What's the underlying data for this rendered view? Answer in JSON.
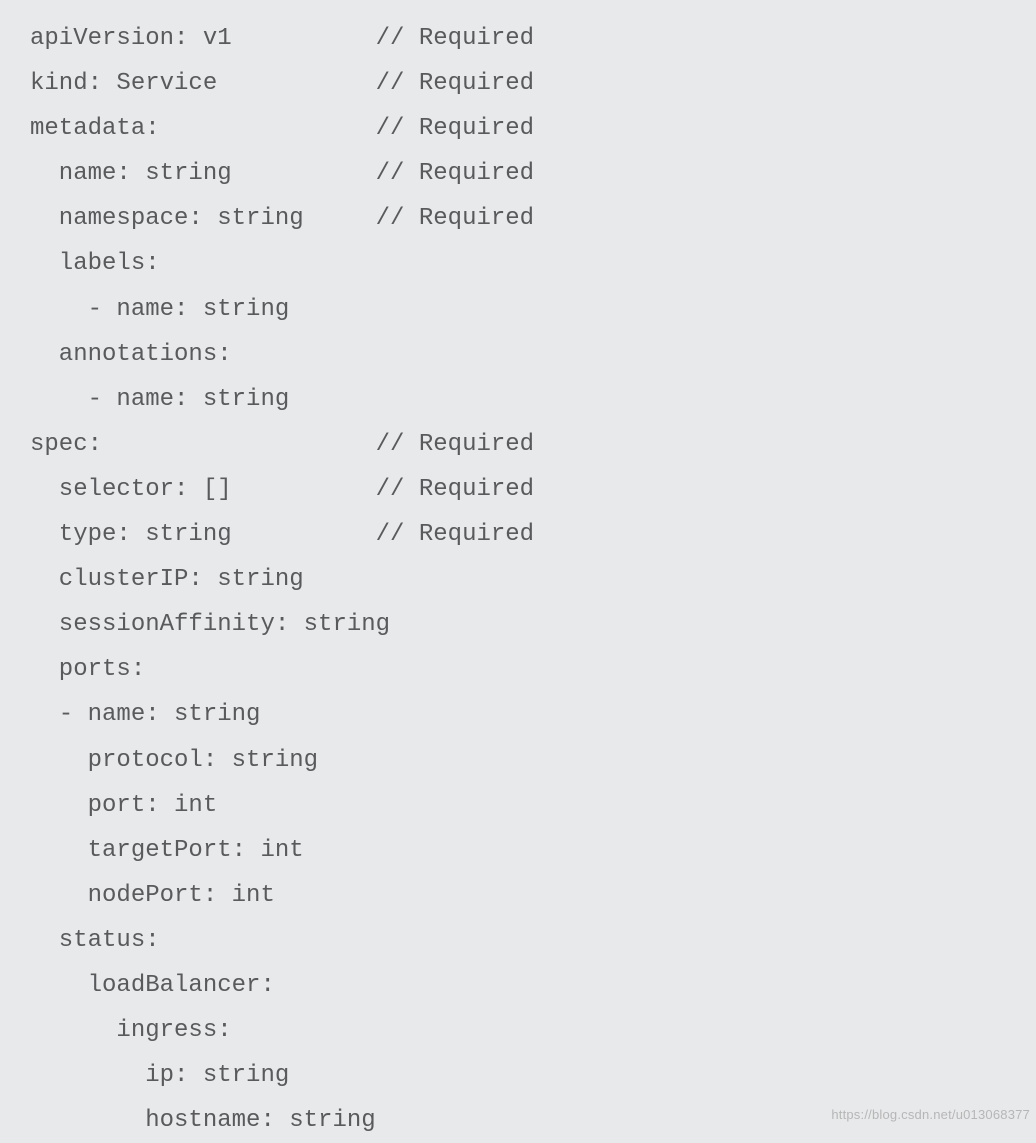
{
  "lines": [
    {
      "code": "apiVersion: v1",
      "pad": 24,
      "comment": "// Required"
    },
    {
      "code": "kind: Service",
      "pad": 24,
      "comment": "// Required"
    },
    {
      "code": "metadata:",
      "pad": 24,
      "comment": "// Required"
    },
    {
      "code": "  name: string",
      "pad": 24,
      "comment": "// Required"
    },
    {
      "code": "  namespace: string",
      "pad": 24,
      "comment": "// Required"
    },
    {
      "code": "  labels:",
      "pad": 0,
      "comment": ""
    },
    {
      "code": "    - name: string",
      "pad": 0,
      "comment": ""
    },
    {
      "code": "  annotations:",
      "pad": 0,
      "comment": ""
    },
    {
      "code": "    - name: string",
      "pad": 0,
      "comment": ""
    },
    {
      "code": "spec:",
      "pad": 24,
      "comment": "// Required"
    },
    {
      "code": "  selector: []",
      "pad": 24,
      "comment": "// Required"
    },
    {
      "code": "  type: string",
      "pad": 24,
      "comment": "// Required"
    },
    {
      "code": "  clusterIP: string",
      "pad": 0,
      "comment": ""
    },
    {
      "code": "  sessionAffinity: string",
      "pad": 0,
      "comment": ""
    },
    {
      "code": "  ports:",
      "pad": 0,
      "comment": ""
    },
    {
      "code": "  - name: string",
      "pad": 0,
      "comment": ""
    },
    {
      "code": "    protocol: string",
      "pad": 0,
      "comment": ""
    },
    {
      "code": "    port: int",
      "pad": 0,
      "comment": ""
    },
    {
      "code": "    targetPort: int",
      "pad": 0,
      "comment": ""
    },
    {
      "code": "    nodePort: int",
      "pad": 0,
      "comment": ""
    },
    {
      "code": "  status:",
      "pad": 0,
      "comment": ""
    },
    {
      "code": "    loadBalancer:",
      "pad": 0,
      "comment": ""
    },
    {
      "code": "      ingress:",
      "pad": 0,
      "comment": ""
    },
    {
      "code": "        ip: string",
      "pad": 0,
      "comment": ""
    },
    {
      "code": "        hostname: string",
      "pad": 0,
      "comment": ""
    }
  ],
  "watermark": "https://blog.csdn.net/u013068377"
}
